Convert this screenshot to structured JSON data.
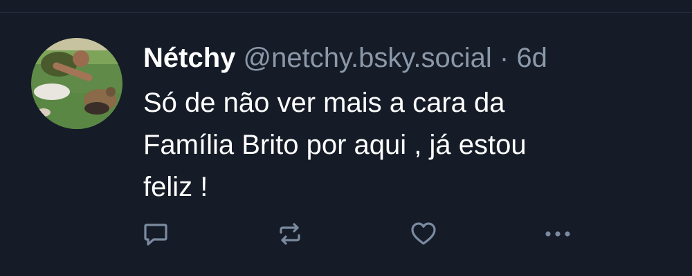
{
  "post": {
    "author": {
      "display_name": "Nétchy",
      "handle": "@netchy.bsky.social"
    },
    "separator": "·",
    "timestamp": "6d",
    "text": "Só de não ver mais a cara da\nFamília Brito por aqui , já estou\nfeliz !"
  },
  "actions": {
    "reply_icon": "speech-bubble-icon",
    "repost_icon": "repost-arrows-icon",
    "like_icon": "heart-icon",
    "more_icon": "ellipsis-icon"
  },
  "colors": {
    "background": "#151c27",
    "primary_text": "#ffffff",
    "secondary_text": "#8b98a9",
    "icon": "#7b8aa0",
    "divider": "#2a3441"
  }
}
